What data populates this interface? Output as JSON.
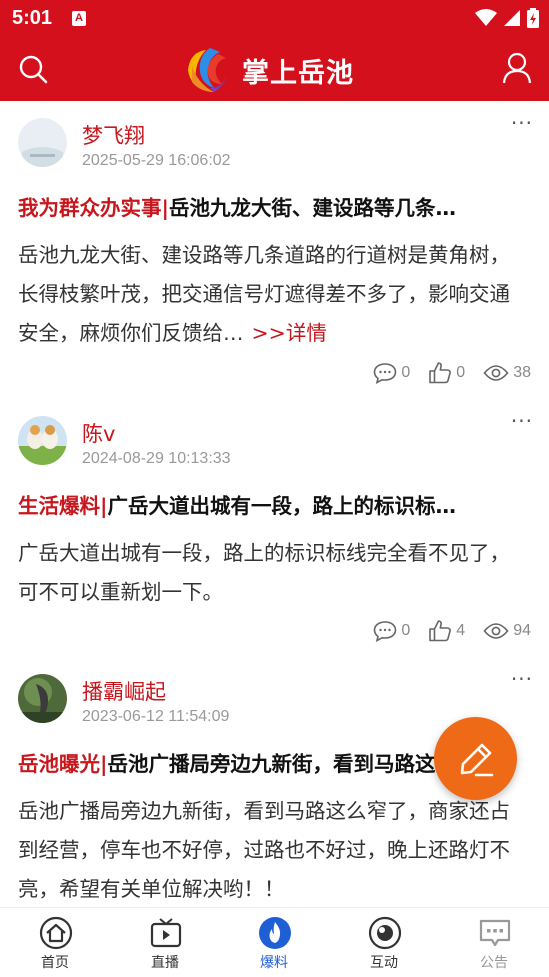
{
  "status_bar": {
    "time": "5:01",
    "notification_icon": "A"
  },
  "header": {
    "title": "掌上岳池"
  },
  "posts": [
    {
      "author": "梦飞翔",
      "time": "2025-05-29 16:06:02",
      "tag": "我为群众办实事",
      "separator": "|",
      "headline": "岳池九龙大街、建设路等几条…",
      "body": "岳池九龙大街、建设路等几条道路的行道树是黄角树，长得枝繁叶茂，把交通信号灯遮得差不多了，影响交通安全，麻烦你们反馈给…",
      "detail_link": ">>详情",
      "comments": "0",
      "likes": "0",
      "views": "38"
    },
    {
      "author": "陈v",
      "time": "2024-08-29 10:13:33",
      "tag": "生活爆料",
      "separator": "|",
      "headline": "广岳大道出城有一段，路上的标识标…",
      "body": "广岳大道出城有一段，路上的标识标线完全看不见了，可不可以重新划一下。",
      "comments": "0",
      "likes": "4",
      "views": "94"
    },
    {
      "author": "播霸崛起",
      "time": "2023-06-12 11:54:09",
      "tag": "岳池曝光",
      "separator": "|",
      "headline": "岳池广播局旁边九新街，看到马路这么窄了",
      "body": "岳池广播局旁边九新街，看到马路这么窄了，商家还占到经营，停车也不好停，过路也不好过，晚上还路灯不亮，希望有关单位解决哟！！"
    }
  ],
  "tabs": [
    {
      "label": "首页",
      "icon": "home-icon"
    },
    {
      "label": "直播",
      "icon": "tv-icon"
    },
    {
      "label": "爆料",
      "icon": "flame-icon"
    },
    {
      "label": "互动",
      "icon": "interact-icon"
    },
    {
      "label": "公告",
      "icon": "notice-icon"
    }
  ],
  "colors": {
    "brand": "#d5101d",
    "accent_tab": "#1f5fd6",
    "fab": "#ee6a16"
  }
}
